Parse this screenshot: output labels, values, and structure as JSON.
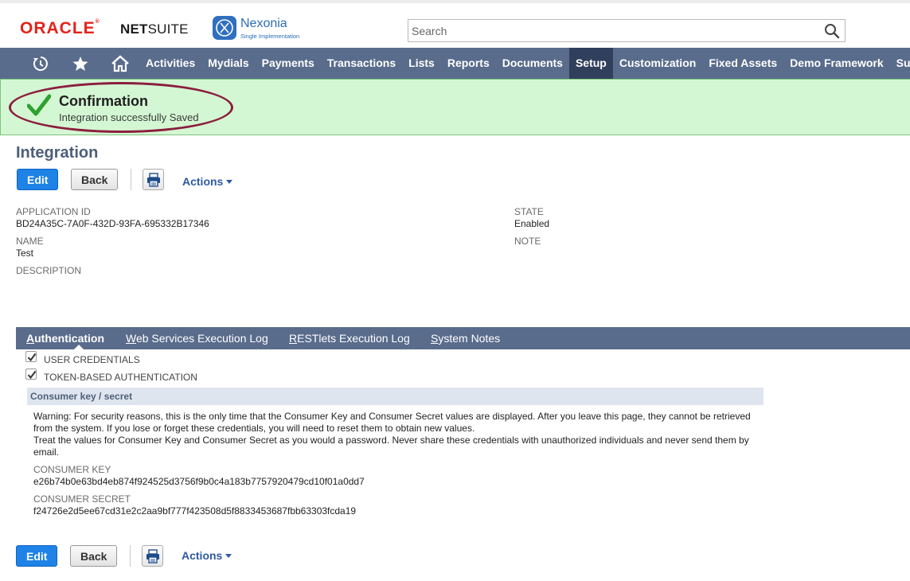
{
  "header": {
    "oracle_logo": "ORACLE",
    "netsuite_logo_bold": "NET",
    "netsuite_logo_rest": "SUITE",
    "nexonia_name": "Nexonia",
    "nexonia_sub": "Single Implementation",
    "search_placeholder": "Search"
  },
  "nav": {
    "icons": [
      "recent-records-icon",
      "star-icon",
      "home-icon"
    ],
    "items": [
      {
        "label": "Activities"
      },
      {
        "label": "Mydials"
      },
      {
        "label": "Payments"
      },
      {
        "label": "Transactions"
      },
      {
        "label": "Lists"
      },
      {
        "label": "Reports"
      },
      {
        "label": "Documents"
      },
      {
        "label": "Setup",
        "active": true
      },
      {
        "label": "Customization"
      },
      {
        "label": "Fixed Assets"
      },
      {
        "label": "Demo Framework"
      },
      {
        "label": "Su"
      }
    ]
  },
  "confirmation": {
    "title": "Confirmation",
    "message": "Integration successfully Saved"
  },
  "page": {
    "title": "Integration"
  },
  "toolbar": {
    "edit_label": "Edit",
    "back_label": "Back",
    "actions_label": "Actions"
  },
  "fields": {
    "application_id": {
      "label": "APPLICATION ID",
      "value": "BD24A35C-7A0F-432D-93FA-695332B17346"
    },
    "name": {
      "label": "NAME",
      "value": "Test"
    },
    "description": {
      "label": "DESCRIPTION",
      "value": ""
    },
    "state": {
      "label": "STATE",
      "value": "Enabled"
    },
    "note": {
      "label": "NOTE",
      "value": ""
    }
  },
  "tabs": [
    {
      "first": "A",
      "rest": "uthentication",
      "active": true
    },
    {
      "first": "W",
      "rest": "eb Services Execution Log"
    },
    {
      "first": "R",
      "rest": "ESTlets Execution Log"
    },
    {
      "first": "S",
      "rest": "ystem Notes"
    }
  ],
  "auth": {
    "user_credentials": {
      "label": "USER CREDENTIALS",
      "checked": true
    },
    "token_based": {
      "label": "TOKEN-BASED AUTHENTICATION",
      "checked": true
    },
    "section_title": "Consumer key / secret",
    "warning_1": "Warning: For security reasons, this is the only time that the Consumer Key and Consumer Secret values are displayed. After you leave this page, they cannot be retrieved from the system. If you lose or forget these credentials, you will need to reset them to obtain new values.",
    "warning_2": "Treat the values for Consumer Key and Consumer Secret as you would a password. Never share these credentials with unauthorized individuals and never send them by email.",
    "consumer_key": {
      "label": "CONSUMER KEY",
      "value": "e26b74b0e63bd4eb874f924525d3756f9b0c4a183b7757920479cd10f01a0dd7"
    },
    "consumer_secret": {
      "label": "CONSUMER SECRET",
      "value": "f24726e2d5ee67cd31e2c2aa9bf777f423508d5f8833453687fbb63303fcda19"
    }
  },
  "colors": {
    "nav_bg": "#5a6c8c",
    "nav_active": "#2f3f5c",
    "confirm_bg": "#d4f7d3",
    "highlight_oval": "#8b1e3f",
    "primary_button": "#1e82e6"
  }
}
